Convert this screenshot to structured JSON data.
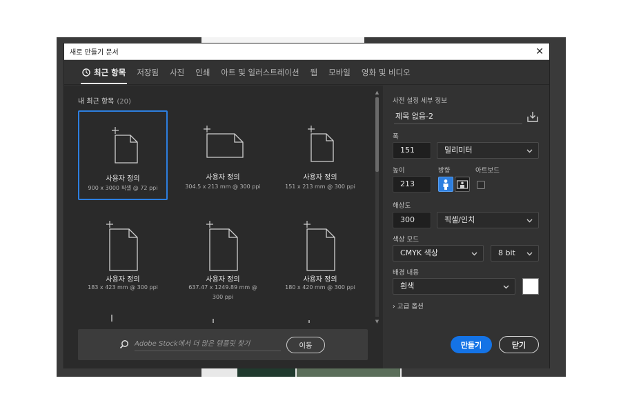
{
  "window": {
    "title": "새로 만들기 문서",
    "close_label": "✕"
  },
  "tabs": [
    {
      "label": "최근 항목",
      "active": true
    },
    {
      "label": "저장됨"
    },
    {
      "label": "사진"
    },
    {
      "label": "인쇄"
    },
    {
      "label": "아트 및 일러스트레이션"
    },
    {
      "label": "웹"
    },
    {
      "label": "모바일"
    },
    {
      "label": "영화 및 비디오"
    }
  ],
  "recent": {
    "label": "내 최근 항목",
    "count": "(20)",
    "items": [
      {
        "name": "사용자 정의",
        "dims": "900 x 3000 픽셀 @ 72 ppi"
      },
      {
        "name": "사용자 정의",
        "dims": "304.5 x 213 mm @ 300 ppi"
      },
      {
        "name": "사용자 정의",
        "dims": "151 x 213 mm @ 300 ppi"
      },
      {
        "name": "사용자 정의",
        "dims": "183 x 423 mm @ 300 ppi"
      },
      {
        "name": "사용자 정의",
        "dims": "637.47 x 1249.89 mm @ 300 ppi"
      },
      {
        "name": "사용자 정의",
        "dims": "180 x 420 mm @ 300 ppi"
      }
    ]
  },
  "stock": {
    "placeholder": "Adobe Stock에서 더 많은 템플릿 찾기",
    "go_label": "이동"
  },
  "preset": {
    "header": "사전 설정 세부 정보",
    "doc_name": "제목 없음-2",
    "width_label": "폭",
    "width_value": "151",
    "width_unit": "밀리미터",
    "height_label": "높이",
    "height_value": "213",
    "orientation_label": "방향",
    "artboard_label": "아트보드",
    "resolution_label": "해상도",
    "resolution_value": "300",
    "resolution_unit": "픽셀/인치",
    "color_mode_label": "색상 모드",
    "color_mode_value": "CMYK 색상",
    "bit_depth_value": "8 bit",
    "background_label": "배경 내용",
    "background_value": "흰색",
    "background_color": "#ffffff",
    "advanced_label": "› 고급 옵션"
  },
  "actions": {
    "create_label": "만들기",
    "close_label": "닫기"
  },
  "colors": {
    "accent": "#1473e6",
    "selection": "#2d7fe0",
    "panel": "#323232",
    "panel_dark": "#2a2a2a"
  }
}
